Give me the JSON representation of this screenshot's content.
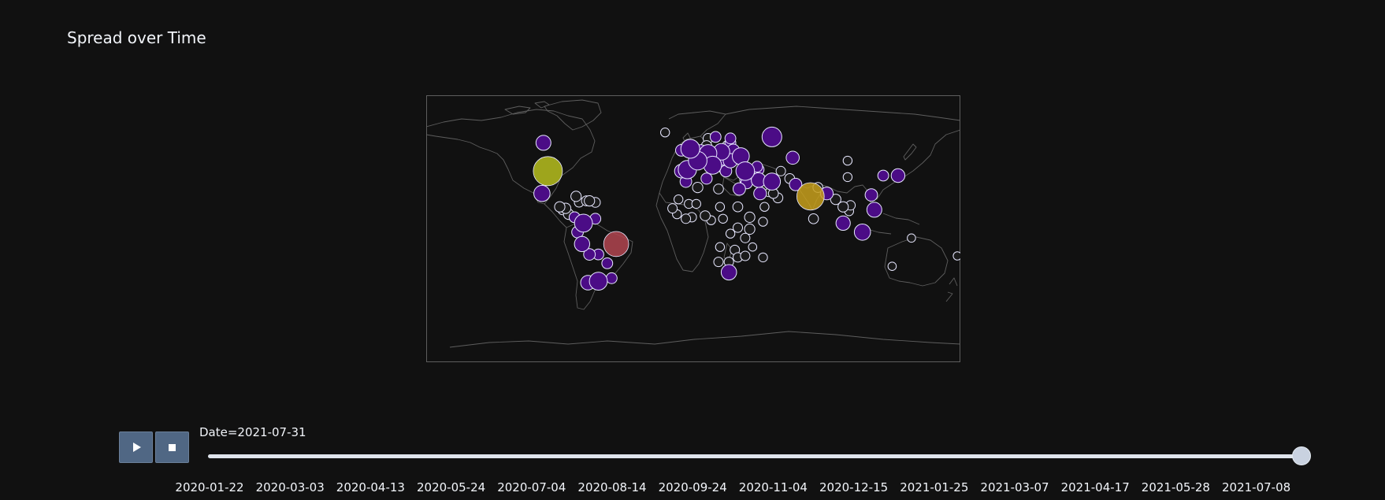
{
  "chart_data": {
    "type": "scatter",
    "title": "Spread over Time",
    "background": "#111111",
    "coastline_color": "#5e5e5e",
    "marker_outline_color": "#e8e8ff",
    "projection": "equirectangular",
    "lon_range": [
      -180,
      180
    ],
    "lat_range": [
      -90,
      90
    ],
    "color_scale": [
      "#2b0a8f",
      "#5a0fa0",
      "#8a2a8f",
      "#b0403f",
      "#c9a21b",
      "#b7c01f"
    ],
    "frame": {
      "date": "2021-07-31"
    },
    "points": [
      {
        "lon": -98,
        "lat": 39,
        "size": 1.0,
        "color": "#b7c01f"
      },
      {
        "lon": 79,
        "lat": 22,
        "size": 0.88,
        "color": "#c8a01c"
      },
      {
        "lon": -52,
        "lat": -10,
        "size": 0.72,
        "color": "#b24550"
      },
      {
        "lon": 53,
        "lat": 62,
        "size": 0.42,
        "color": "#4b0c86"
      },
      {
        "lon": -2,
        "lat": 54,
        "size": 0.38,
        "color": "#4b0c86"
      },
      {
        "lon": 3,
        "lat": 46,
        "size": 0.37,
        "color": "#4b0c86"
      },
      {
        "lon": 35,
        "lat": 39,
        "size": 0.37,
        "color": "#4b0c86"
      },
      {
        "lon": -4,
        "lat": 40,
        "size": 0.35,
        "color": "#4b0c86"
      },
      {
        "lon": 13,
        "lat": 43,
        "size": 0.34,
        "color": "#4b0c86"
      },
      {
        "lon": 10,
        "lat": 51,
        "size": 0.32,
        "color": "#4b0c86"
      },
      {
        "lon": -74,
        "lat": 4,
        "size": 0.34,
        "color": "#4b0c86"
      },
      {
        "lon": -64,
        "lat": -35,
        "size": 0.34,
        "color": "#4b0c86"
      },
      {
        "lon": 32,
        "lat": 49,
        "size": 0.3,
        "color": "#4b0c86"
      },
      {
        "lon": 19,
        "lat": 52,
        "size": 0.28,
        "color": "#4b0c86"
      },
      {
        "lon": 53,
        "lat": 32,
        "size": 0.3,
        "color": "#4b0c86"
      },
      {
        "lon": -102,
        "lat": 24,
        "size": 0.27,
        "color": "#4b0c86"
      },
      {
        "lon": -101,
        "lat": 58,
        "size": 0.22,
        "color": "#4b0c86"
      },
      {
        "lon": 114,
        "lat": -2,
        "size": 0.27,
        "color": "#4b0c86"
      },
      {
        "lon": 24,
        "lat": -29,
        "size": 0.24,
        "color": "#4b0c86"
      },
      {
        "lon": -75,
        "lat": -10,
        "size": 0.23,
        "color": "#4b0c86"
      },
      {
        "lon": 122,
        "lat": 13,
        "size": 0.22,
        "color": "#4b0c86"
      },
      {
        "lon": -71,
        "lat": -36,
        "size": 0.21,
        "color": "#4b0c86"
      },
      {
        "lon": 101,
        "lat": 4,
        "size": 0.2,
        "color": "#4b0c86"
      },
      {
        "lon": 44,
        "lat": 33,
        "size": 0.21,
        "color": "#4b0c86"
      },
      {
        "lon": 138,
        "lat": 36,
        "size": 0.18,
        "color": "#4b0c86"
      },
      {
        "lon": 5,
        "lat": 52,
        "size": 0.2,
        "color": "#4b0c86"
      },
      {
        "lon": 25,
        "lat": 46,
        "size": 0.2,
        "color": "#4b0c86"
      },
      {
        "lon": 15,
        "lat": 50,
        "size": 0.18,
        "color": "#4b0c86"
      },
      {
        "lon": -8,
        "lat": 39,
        "size": 0.18,
        "color": "#4b0c86"
      },
      {
        "lon": 67,
        "lat": 48,
        "size": 0.16,
        "color": "#4b0c86"
      },
      {
        "lon": 120,
        "lat": 23,
        "size": 0.14,
        "color": "#4b0c86"
      },
      {
        "lon": 36,
        "lat": 31,
        "size": 0.12,
        "color": "#4b0c86"
      },
      {
        "lon": 45,
        "lat": 24,
        "size": 0.15,
        "color": "#4b0c86"
      },
      {
        "lon": 90,
        "lat": 24,
        "size": 0.15,
        "color": "#4b0c86"
      },
      {
        "lon": 69,
        "lat": 30,
        "size": 0.14,
        "color": "#4b0c86"
      },
      {
        "lon": 31,
        "lat": 27,
        "size": 0.14,
        "color": "#4b0c86"
      },
      {
        "lon": 27,
        "lat": 53,
        "size": 0.14,
        "color": "#4b0c86"
      },
      {
        "lon": 4,
        "lat": 50,
        "size": 0.13,
        "color": "#4b0c86"
      },
      {
        "lon": 8,
        "lat": 47,
        "size": 0.13,
        "color": "#4b0c86"
      },
      {
        "lon": 20,
        "lat": 47,
        "size": 0.13,
        "color": "#4b0c86"
      },
      {
        "lon": 22,
        "lat": 39,
        "size": 0.12,
        "color": "#4b0c86"
      },
      {
        "lon": 128,
        "lat": 36,
        "size": 0.1,
        "color": "#4b0c86"
      },
      {
        "lon": -70,
        "lat": -17,
        "size": 0.12,
        "color": "#4b0c86"
      },
      {
        "lon": -78,
        "lat": -2,
        "size": 0.12,
        "color": "#4b0c86"
      },
      {
        "lon": -66,
        "lat": 7,
        "size": 0.1,
        "color": "#4b0c86"
      },
      {
        "lon": -58,
        "lat": -23,
        "size": 0.1,
        "color": "#4b0c86"
      },
      {
        "lon": -55,
        "lat": -33,
        "size": 0.1,
        "color": "#4b0c86"
      },
      {
        "lon": -64,
        "lat": -17,
        "size": 0.1,
        "color": "#4b0c86"
      },
      {
        "lon": -80,
        "lat": 8,
        "size": 0.1,
        "color": "#4b0c86"
      },
      {
        "lon": -84,
        "lat": 10,
        "size": 0.09,
        "color": "#4b0c86"
      },
      {
        "lon": -86,
        "lat": 14,
        "size": 0.09,
        "color": "#4b0c86"
      },
      {
        "lon": -90,
        "lat": 15,
        "size": 0.09,
        "color": "#4b0c86"
      },
      {
        "lon": -79,
        "lat": 22,
        "size": 0.09,
        "color": "#4b0c86"
      },
      {
        "lon": -70,
        "lat": 19,
        "size": 0.09,
        "color": "#4b0c86"
      },
      {
        "lon": -72,
        "lat": 19,
        "size": 0.08,
        "color": "#4b0c86"
      },
      {
        "lon": -66,
        "lat": 18,
        "size": 0.08,
        "color": "#4b0c86"
      },
      {
        "lon": -77,
        "lat": 18,
        "size": 0.07,
        "color": "#4b0c86"
      },
      {
        "lon": -88,
        "lat": 13,
        "size": 0.08,
        "color": "#4b0c86"
      },
      {
        "lon": -5,
        "lat": 32,
        "size": 0.12,
        "color": "#4b0c86"
      },
      {
        "lon": 9,
        "lat": 34,
        "size": 0.11,
        "color": "#4b0c86"
      },
      {
        "lon": 3,
        "lat": 28,
        "size": 0.09,
        "color": "#4b0c86"
      },
      {
        "lon": 17,
        "lat": 27,
        "size": 0.08,
        "color": "#4b0c86"
      },
      {
        "lon": 30,
        "lat": 15,
        "size": 0.08,
        "color": "#4b0c86"
      },
      {
        "lon": 38,
        "lat": 8,
        "size": 0.09,
        "color": "#4b0c86"
      },
      {
        "lon": 38,
        "lat": 0,
        "size": 0.09,
        "color": "#4b0c86"
      },
      {
        "lon": 8,
        "lat": 9,
        "size": 0.08,
        "color": "#4b0c86"
      },
      {
        "lon": -1,
        "lat": 8,
        "size": 0.07,
        "color": "#4b0c86"
      },
      {
        "lon": -14,
        "lat": 14,
        "size": 0.07,
        "color": "#4b0c86"
      },
      {
        "lon": 12,
        "lat": 6,
        "size": 0.06,
        "color": "#4b0c86"
      },
      {
        "lon": 25,
        "lat": -3,
        "size": 0.06,
        "color": "#4b0c86"
      },
      {
        "lon": 18,
        "lat": -12,
        "size": 0.06,
        "color": "#4b0c86"
      },
      {
        "lon": 28,
        "lat": -14,
        "size": 0.07,
        "color": "#4b0c86"
      },
      {
        "lon": 30,
        "lat": -19,
        "size": 0.07,
        "color": "#4b0c86"
      },
      {
        "lon": 35,
        "lat": -18,
        "size": 0.07,
        "color": "#4b0c86"
      },
      {
        "lon": 35,
        "lat": -6,
        "size": 0.07,
        "color": "#4b0c86"
      },
      {
        "lon": 47,
        "lat": -19,
        "size": 0.06,
        "color": "#4b0c86"
      },
      {
        "lon": 17,
        "lat": -22,
        "size": 0.07,
        "color": "#4b0c86"
      },
      {
        "lon": 24,
        "lat": -22,
        "size": 0.07,
        "color": "#4b0c86"
      },
      {
        "lon": 47,
        "lat": 5,
        "size": 0.06,
        "color": "#4b0c86"
      },
      {
        "lon": 48,
        "lat": 15,
        "size": 0.06,
        "color": "#4b0c86"
      },
      {
        "lon": 57,
        "lat": 21,
        "size": 0.08,
        "color": "#4b0c86"
      },
      {
        "lon": 51,
        "lat": 25,
        "size": 0.07,
        "color": "#4b0c86"
      },
      {
        "lon": 54,
        "lat": 24,
        "size": 0.08,
        "color": "#4b0c86"
      },
      {
        "lon": 47,
        "lat": 29,
        "size": 0.07,
        "color": "#4b0c86"
      },
      {
        "lon": 50,
        "lat": 26,
        "size": 0.06,
        "color": "#4b0c86"
      },
      {
        "lon": 59,
        "lat": 39,
        "size": 0.07,
        "color": "#4b0c86"
      },
      {
        "lon": 65,
        "lat": 34,
        "size": 0.08,
        "color": "#4b0c86"
      },
      {
        "lon": 84,
        "lat": 28,
        "size": 0.08,
        "color": "#4b0c86"
      },
      {
        "lon": 81,
        "lat": 7,
        "size": 0.08,
        "color": "#4b0c86"
      },
      {
        "lon": 96,
        "lat": 20,
        "size": 0.09,
        "color": "#4b0c86"
      },
      {
        "lon": 101,
        "lat": 15,
        "size": 0.09,
        "color": "#4b0c86"
      },
      {
        "lon": 106,
        "lat": 16,
        "size": 0.07,
        "color": "#4b0c86"
      },
      {
        "lon": 105,
        "lat": 12,
        "size": 0.06,
        "color": "#4b0c86"
      },
      {
        "lon": 104,
        "lat": 35,
        "size": 0.06,
        "color": "#4b0c86"
      },
      {
        "lon": 104,
        "lat": 46,
        "size": 0.06,
        "color": "#4b0c86"
      },
      {
        "lon": 147,
        "lat": -6,
        "size": 0.05,
        "color": "#4b0c86"
      },
      {
        "lon": 134,
        "lat": -25,
        "size": 0.05,
        "color": "#4b0c86"
      },
      {
        "lon": 178,
        "lat": -18,
        "size": 0.05,
        "color": "#4b0c86"
      },
      {
        "lon": 44,
        "lat": 40,
        "size": 0.1,
        "color": "#4b0c86"
      },
      {
        "lon": 43,
        "lat": 42,
        "size": 0.1,
        "color": "#4b0c86"
      },
      {
        "lon": 35,
        "lat": 33,
        "size": 0.1,
        "color": "#4b0c86"
      },
      {
        "lon": 38,
        "lat": 35,
        "size": 0.07,
        "color": "#4b0c86"
      },
      {
        "lon": 28,
        "lat": 47,
        "size": 0.1,
        "color": "#4b0c86"
      },
      {
        "lon": 21,
        "lat": 44,
        "size": 0.11,
        "color": "#4b0c86"
      },
      {
        "lon": 16,
        "lat": 45,
        "size": 0.1,
        "color": "#4b0c86"
      },
      {
        "lon": 14,
        "lat": 47,
        "size": 0.11,
        "color": "#4b0c86"
      },
      {
        "lon": 25,
        "lat": 58,
        "size": 0.1,
        "color": "#4b0c86"
      },
      {
        "lon": 25,
        "lat": 61,
        "size": 0.1,
        "color": "#4b0c86"
      },
      {
        "lon": 15,
        "lat": 62,
        "size": 0.1,
        "color": "#4b0c86"
      },
      {
        "lon": 9,
        "lat": 56,
        "size": 0.09,
        "color": "#4b0c86"
      },
      {
        "lon": 10,
        "lat": 61,
        "size": 0.08,
        "color": "#4b0c86"
      },
      {
        "lon": -8,
        "lat": 53,
        "size": 0.12,
        "color": "#4b0c86"
      },
      {
        "lon": -19,
        "lat": 65,
        "size": 0.06,
        "color": "#4b0c86"
      },
      {
        "lon": 23,
        "lat": 56,
        "size": 0.09,
        "color": "#4b0c86"
      },
      {
        "lon": 24,
        "lat": 55,
        "size": 0.09,
        "color": "#4b0c86"
      },
      {
        "lon": 20,
        "lat": 41,
        "size": 0.08,
        "color": "#4b0c86"
      },
      {
        "lon": 18,
        "lat": 43,
        "size": 0.08,
        "color": "#4b0c86"
      },
      {
        "lon": -3,
        "lat": 17,
        "size": 0.06,
        "color": "#4b0c86"
      },
      {
        "lon": 2,
        "lat": 17,
        "size": 0.06,
        "color": "#4b0c86"
      },
      {
        "lon": -10,
        "lat": 20,
        "size": 0.06,
        "color": "#4b0c86"
      },
      {
        "lon": -11,
        "lat": 10,
        "size": 0.06,
        "color": "#4b0c86"
      },
      {
        "lon": -5,
        "lat": 7,
        "size": 0.07,
        "color": "#4b0c86"
      },
      {
        "lon": 20,
        "lat": 7,
        "size": 0.06,
        "color": "#4b0c86"
      },
      {
        "lon": 18,
        "lat": 15,
        "size": 0.06,
        "color": "#4b0c86"
      },
      {
        "lon": 30,
        "lat": 1,
        "size": 0.07,
        "color": "#4b0c86"
      },
      {
        "lon": 40,
        "lat": -12,
        "size": 0.05,
        "color": "#4b0c86"
      }
    ]
  },
  "slider": {
    "current_label": "Date=2021-07-31",
    "value_fraction": 1.0,
    "tick_labels": [
      "2020-01-22",
      "2020-03-03",
      "2020-04-13",
      "2020-05-24",
      "2020-07-04",
      "2020-08-14",
      "2020-09-24",
      "2020-11-04",
      "2020-12-15",
      "2021-01-25",
      "2021-03-07",
      "2021-04-17",
      "2021-05-28",
      "2021-07-08"
    ]
  },
  "controls": {
    "play_icon": "play-icon",
    "stop_icon": "stop-icon"
  }
}
